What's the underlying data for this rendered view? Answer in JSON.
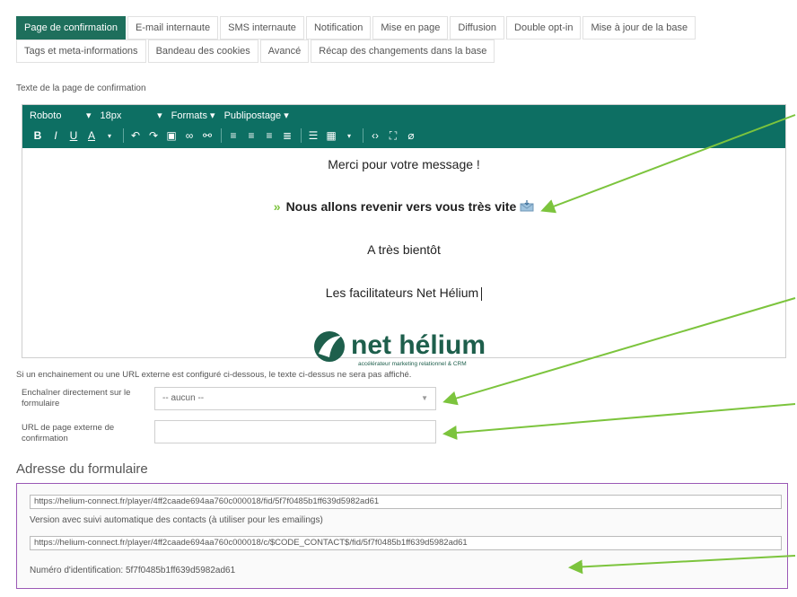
{
  "tabs": {
    "row1": [
      "Page de confirmation",
      "E-mail internaute",
      "SMS internaute",
      "Notification",
      "Mise en page",
      "Diffusion",
      "Double opt-in",
      "Mise à jour de la base"
    ],
    "row2": [
      "Tags et meta-informations",
      "Bandeau des cookies",
      "Avancé",
      "Récap des changements dans la base"
    ],
    "active": "Page de confirmation"
  },
  "editor_section_label": "Texte de la page de confirmation",
  "toolbar": {
    "font": "Roboto",
    "size": "18px",
    "formats": "Formats",
    "mailmerge": "Publipostage"
  },
  "content": {
    "line1": "Merci pour votre message !",
    "line2_prefix": "»",
    "line2": "Nous allons revenir vers vous très vite",
    "line3": "A très bientôt",
    "line4": "Les facilitateurs Net Hélium",
    "logo_text": "net hélium",
    "logo_tagline": "accélérateur marketing relationnel & CRM"
  },
  "note": "Si un enchainement ou une URL externe est configuré ci-dessous, le texte ci-dessus ne sera pas affiché.",
  "fields": {
    "chain_label": "Enchaîner directement sur le formulaire",
    "chain_value": "-- aucun --",
    "url_label": "URL de page externe de confirmation",
    "url_value": ""
  },
  "address": {
    "title": "Adresse du formulaire",
    "url1": "https://helium-connect.fr/player/4ff2caade694aa760c000018/fid/5f7f0485b1ff639d5982ad61",
    "tracking_label": "Version avec suivi automatique des contacts (à utiliser pour les emailings)",
    "url2": "https://helium-connect.fr/player/4ff2caade694aa760c000018/c/$CODE_CONTACT$/fid/5f7f0485b1ff639d5982ad61",
    "id_label": "Numéro d'identification: 5f7f0485b1ff639d5982ad61"
  },
  "colors": {
    "accent": "#1e6f5c",
    "toolbar": "#0d6f63",
    "arrow": "#7cc43d",
    "address_border": "#9b59b6"
  }
}
